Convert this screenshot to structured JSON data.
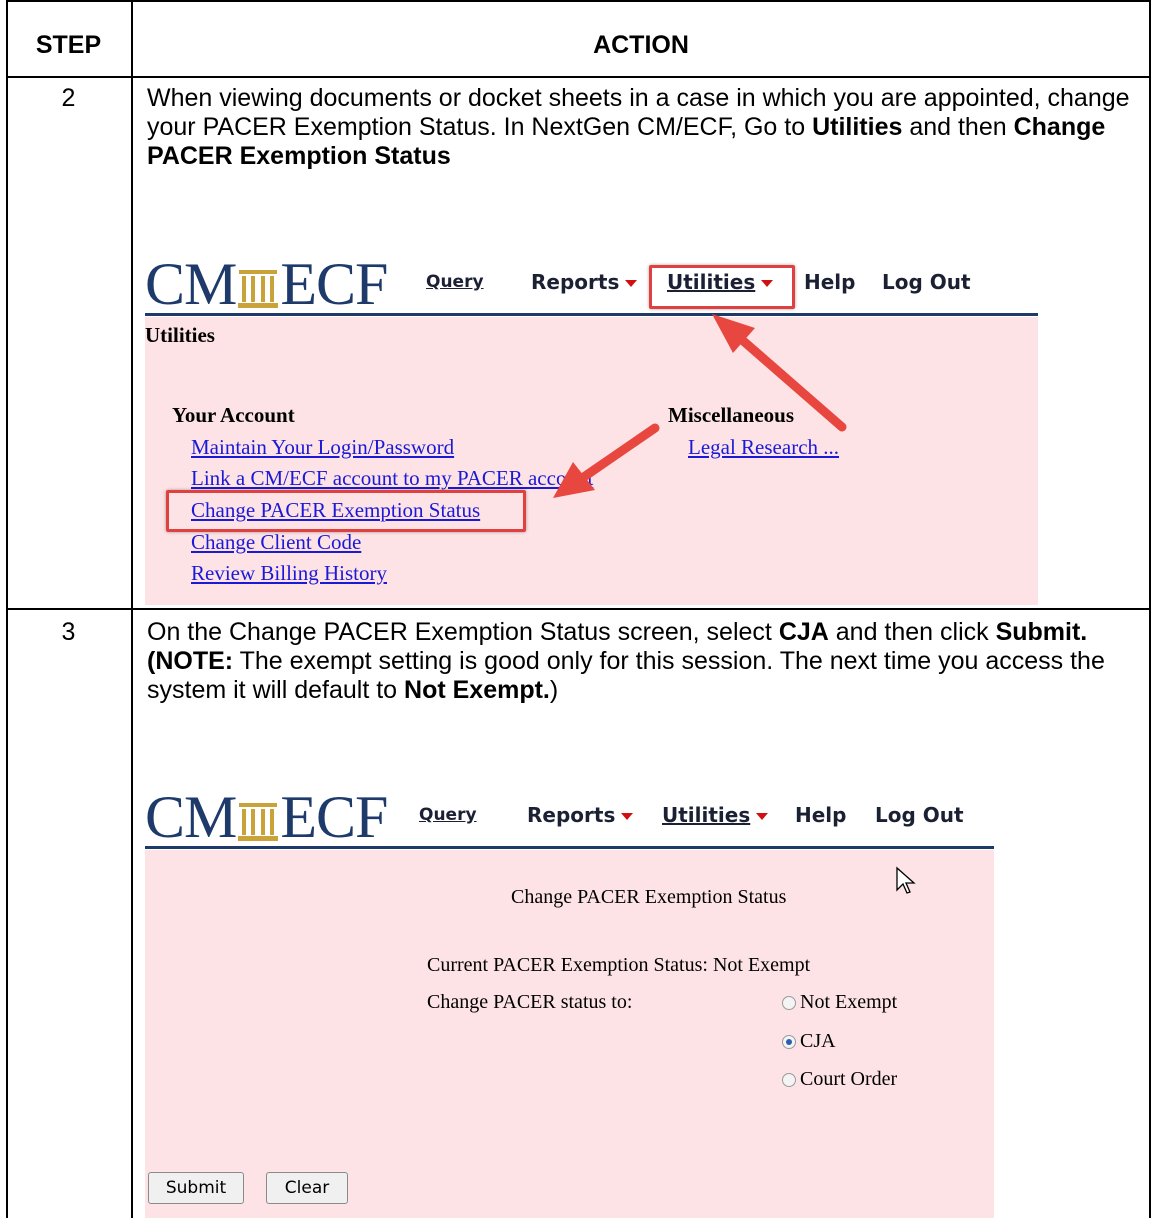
{
  "table": {
    "header_step": "STEP",
    "header_action": "ACTION"
  },
  "rows": [
    {
      "step": "2",
      "text_parts": [
        "When viewing documents or docket sheets in a case in which you are appointed, change your PACER Exemption Status. In NextGen CM/ECF, Go to ",
        "Utilities",
        " and then ",
        "Change PACER Exemption Status"
      ]
    },
    {
      "step": "3",
      "text_parts": [
        "On the Change PACER Exemption Status screen, select ",
        "CJA",
        " and then click ",
        "Submit.",
        "(NOTE:",
        " The exempt setting is good only for this session. The next time you access the system it will default to ",
        "Not Exempt.",
        ")"
      ]
    }
  ],
  "cmecf": {
    "logo_left": "CM",
    "logo_right": "ECF",
    "menu": [
      "Query",
      "Reports",
      "Utilities",
      "Help",
      "Log Out"
    ],
    "utilities_page": {
      "title": "Utilities",
      "your_account": "Your Account",
      "miscellaneous": "Miscellaneous",
      "account_links": [
        "Maintain Your Login/Password",
        "Link a CM/ECF account to my PACER account",
        "Change PACER Exemption Status",
        "Change Client Code",
        "Review Billing History"
      ],
      "misc_links": [
        "Legal Research ..."
      ]
    },
    "exemption_page": {
      "title": "Change PACER Exemption Status",
      "current_label": "Current PACER Exemption Status: Not Exempt",
      "change_label": "Change PACER status to:",
      "options": [
        "Not Exempt",
        "CJA",
        "Court Order"
      ],
      "selected": "CJA",
      "submit": "Submit",
      "clear": "Clear"
    }
  },
  "colors": {
    "accent_red": "#e04040",
    "pink_panel": "#fde3e5",
    "logo_blue": "#1d3a6b",
    "link_blue": "#1a1ad6"
  }
}
